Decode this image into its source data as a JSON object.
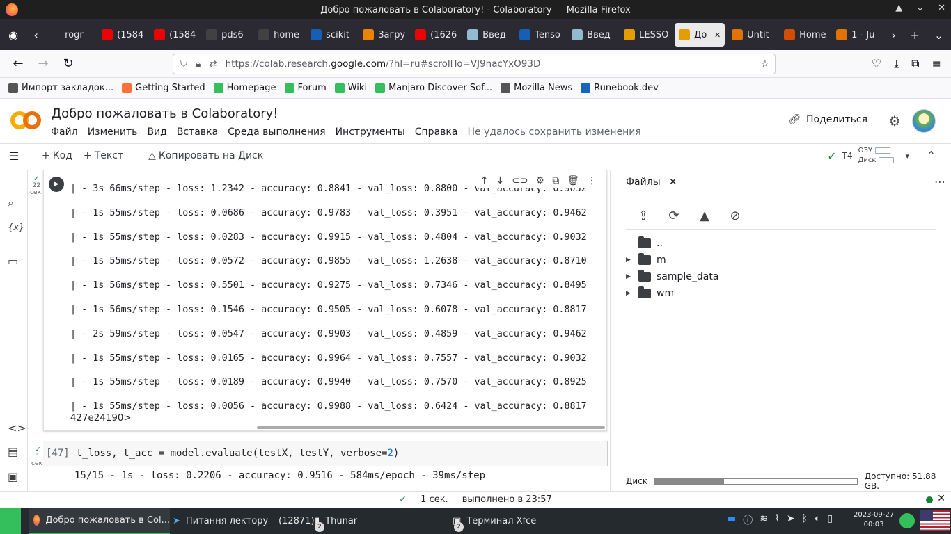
{
  "window": {
    "title": "Добро пожаловать в Colaboratory! - Colaboratory — Mozilla Firefox"
  },
  "tabs": [
    {
      "label": "rogr",
      "color": "#2b2a33"
    },
    {
      "label": "(1584",
      "color": "#ff0000"
    },
    {
      "label": "(1584",
      "color": "#ff0000"
    },
    {
      "label": "pds6",
      "color": "#444"
    },
    {
      "label": "home",
      "color": "#444"
    },
    {
      "label": "scikit",
      "color": "#1565c0"
    },
    {
      "label": "Загру",
      "color": "#ff8f00"
    },
    {
      "label": "(1626",
      "color": "#ff0000"
    },
    {
      "label": "Введ",
      "color": "#9ecae1"
    },
    {
      "label": "Tenso",
      "color": "#1565c0"
    },
    {
      "label": "Введ",
      "color": "#9ecae1"
    },
    {
      "label": "LESSO",
      "color": "#f9ab00"
    },
    {
      "label": "До",
      "color": "#f9ab00",
      "active": true
    },
    {
      "label": "Untit",
      "color": "#f57c00"
    },
    {
      "label": "Home",
      "color": "#e65100"
    },
    {
      "label": "1 - Ju",
      "color": "#f57c00"
    }
  ],
  "url": {
    "prefix": "https://colab.research.",
    "host": "google.com",
    "rest": "/?hl=ru#scrollTo=VJ9hacYxO93D"
  },
  "bookmarks": [
    {
      "label": "Импорт закладок...",
      "color": "#555"
    },
    {
      "label": "Getting Started",
      "color": "#ff7139"
    },
    {
      "label": "Homepage",
      "color": "#35bf5c"
    },
    {
      "label": "Forum",
      "color": "#35bf5c"
    },
    {
      "label": "Wiki",
      "color": "#35bf5c"
    },
    {
      "label": "Manjaro Discover Sof...",
      "color": "#35bf5c"
    },
    {
      "label": "Mozilla News",
      "color": "#555"
    },
    {
      "label": "Runebook.dev",
      "color": "#1565c0"
    }
  ],
  "colab": {
    "title": "Добро пожаловать в Colaboratory!",
    "menu": [
      "Файл",
      "Изменить",
      "Вид",
      "Вставка",
      "Среда выполнения",
      "Инструменты",
      "Справка"
    ],
    "save_warning": "Не удалось сохранить изменения",
    "share": "Поделиться"
  },
  "toolbar": {
    "add_code": "Код",
    "add_text": "Текст",
    "copy_drive": "Копировать на Диск",
    "runtime": "T4",
    "ram": "ОЗУ",
    "disk": "Диск"
  },
  "cell1": {
    "exec_count": "22",
    "exec_unit": "сек.",
    "lines": [
      "| - 3s 66ms/step - loss: 1.2342 - accuracy: 0.8841 - val_loss: 0.8800 - val_accuracy: 0.9032",
      "| - 1s 55ms/step - loss: 0.0686 - accuracy: 0.9783 - val_loss: 0.3951 - val_accuracy: 0.9462",
      "| - 1s 55ms/step - loss: 0.0283 - accuracy: 0.9915 - val_loss: 0.4804 - val_accuracy: 0.9032",
      "| - 1s 55ms/step - loss: 0.0572 - accuracy: 0.9855 - val_loss: 1.2638 - val_accuracy: 0.8710",
      "| - 1s 56ms/step - loss: 0.5501 - accuracy: 0.9275 - val_loss: 0.7346 - val_accuracy: 0.8495",
      "| - 1s 56ms/step - loss: 0.1546 - accuracy: 0.9505 - val_loss: 0.6078 - val_accuracy: 0.8817",
      "| - 2s 59ms/step - loss: 0.0547 - accuracy: 0.9903 - val_loss: 0.4859 - val_accuracy: 0.9462",
      "| - 1s 55ms/step - loss: 0.0165 - accuracy: 0.9964 - val_loss: 0.7557 - val_accuracy: 0.9032",
      "| - 1s 55ms/step - loss: 0.0189 - accuracy: 0.9940 - val_loss: 0.7570 - val_accuracy: 0.8925",
      "| - 1s 55ms/step - loss: 0.0056 - accuracy: 0.9988 - val_loss: 0.6424 - val_accuracy: 0.8817"
    ],
    "last_line": "427e24190>"
  },
  "cell2": {
    "exec_count": "1",
    "exec_unit": "сек.",
    "prompt": "[47]",
    "code_pre": "t_loss, t_acc = model.evaluate(testX, testY, verbose=",
    "code_num": "2",
    "code_post": ")",
    "output": "15/15 - 1s - loss: 0.2206 - accuracy: 0.9516 - 584ms/epoch - 39ms/step"
  },
  "files": {
    "title": "Файлы",
    "items": [
      {
        "name": "..",
        "type": "up"
      },
      {
        "name": "m",
        "type": "folder"
      },
      {
        "name": "sample_data",
        "type": "folder"
      },
      {
        "name": "wm",
        "type": "folder"
      }
    ],
    "disk_label": "Диск",
    "disk_used_fraction": 0.34,
    "disk_available": "Доступно: 51.88 GB."
  },
  "status": {
    "time": "1 сек.",
    "done": "выполнено в 23:57"
  },
  "taskbar": {
    "tasks": [
      {
        "label": "Добро пожаловать в Col...",
        "active": true
      },
      {
        "label": "Питання лектору – (12871)"
      },
      {
        "label": "Thunar",
        "badge": "2"
      },
      {
        "label": "Терминал Xfce",
        "badge": "2"
      }
    ],
    "date": "2023-09-27",
    "time": "00:03"
  }
}
